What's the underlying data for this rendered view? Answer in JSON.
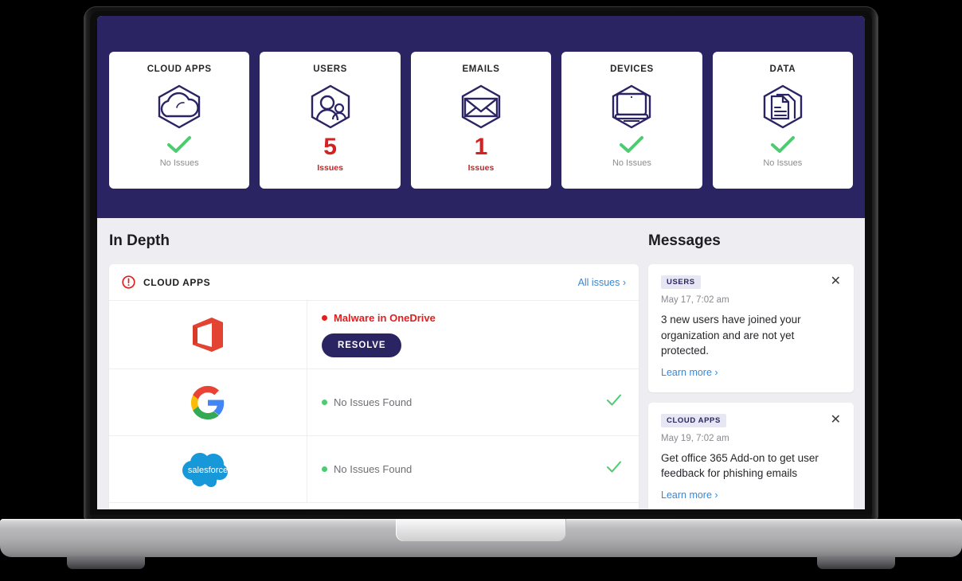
{
  "theme": {
    "header_band": "#2b2463",
    "body_bg": "#eeeef2",
    "accent_navy": "#2b2463",
    "alert_red": "#d42121",
    "ok_green": "#4ecb71",
    "link_blue": "#3b87d0"
  },
  "stats": [
    {
      "title": "CLOUD APPS",
      "icon": "cloud-hexagon-icon",
      "state": "ok",
      "count": null,
      "label": "No Issues"
    },
    {
      "title": "USERS",
      "icon": "users-hexagon-icon",
      "state": "alert",
      "count": "5",
      "label": "Issues"
    },
    {
      "title": "EMAILS",
      "icon": "envelope-hexagon-icon",
      "state": "alert",
      "count": "1",
      "label": "Issues"
    },
    {
      "title": "DEVICES",
      "icon": "monitor-hexagon-icon",
      "state": "ok",
      "count": null,
      "label": "No Issues"
    },
    {
      "title": "DATA",
      "icon": "document-hexagon-icon",
      "state": "ok",
      "count": null,
      "label": "No Issues"
    }
  ],
  "in_depth": {
    "heading": "In Depth",
    "panel": {
      "icon": "alert-circle-icon",
      "title": "CLOUD APPS",
      "all_issues_label": "All issues ›"
    },
    "rows": [
      {
        "app": "office365",
        "logo_name": "office-365-logo",
        "status": "Malware in OneDrive",
        "severity": "alert",
        "action_label": "RESOLVE",
        "has_check": false
      },
      {
        "app": "google",
        "logo_name": "google-logo",
        "status": "No Issues Found",
        "severity": "ok",
        "action_label": null,
        "has_check": true
      },
      {
        "app": "salesforce",
        "logo_name": "salesforce-logo",
        "logo_text": "salesforce",
        "status": "No Issues Found",
        "severity": "ok",
        "action_label": null,
        "has_check": true
      }
    ]
  },
  "messages": {
    "heading": "Messages",
    "close_glyph": "✕",
    "items": [
      {
        "badge": "USERS",
        "date": "May 17, 7:02 am",
        "body": "3 new users have joined your organization and are not yet protected.",
        "link": "Learn more ›"
      },
      {
        "badge": "CLOUD APPS",
        "date": "May 19, 7:02 am",
        "body": "Get office 365 Add-on to get user feedback for phishing emails",
        "link": "Learn more ›"
      }
    ]
  }
}
